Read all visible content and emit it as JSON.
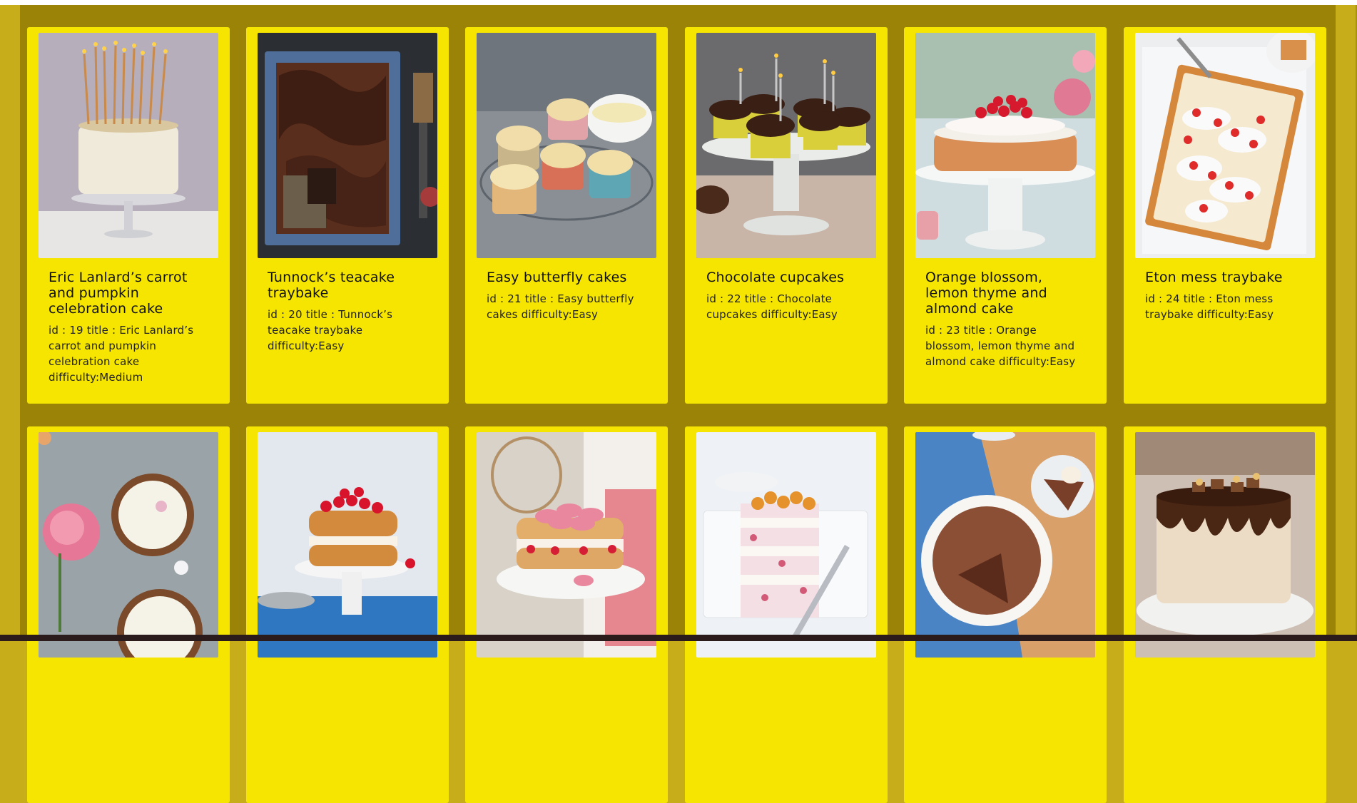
{
  "recipes": [
    {
      "title": "Eric Lanlard’s carrot and pumpkin celebration cake",
      "desc": "id : 19 title : Eric Lanlard’s carrot and pumpkin celebration cake difficulty:Medium"
    },
    {
      "title": "Tunnock’s teacake traybake",
      "desc": "id : 20 title : Tunnock’s teacake traybake difficulty:Easy"
    },
    {
      "title": "Easy butterfly cakes",
      "desc": "id : 21 title : Easy butterfly cakes difficulty:Easy"
    },
    {
      "title": "Chocolate cupcakes",
      "desc": "id : 22 title : Chocolate cupcakes difficulty:Easy"
    },
    {
      "title": "Orange blossom, lemon thyme and almond cake",
      "desc": "id : 23 title : Orange blossom, lemon thyme and almond cake difficulty:Easy"
    },
    {
      "title": "Eton mess traybake",
      "desc": "id : 24 title : Eton mess traybake difficulty:Easy"
    }
  ],
  "colors": {
    "card": "#f5e500",
    "panel": "#9a8307",
    "page": "#c8ad1a"
  }
}
